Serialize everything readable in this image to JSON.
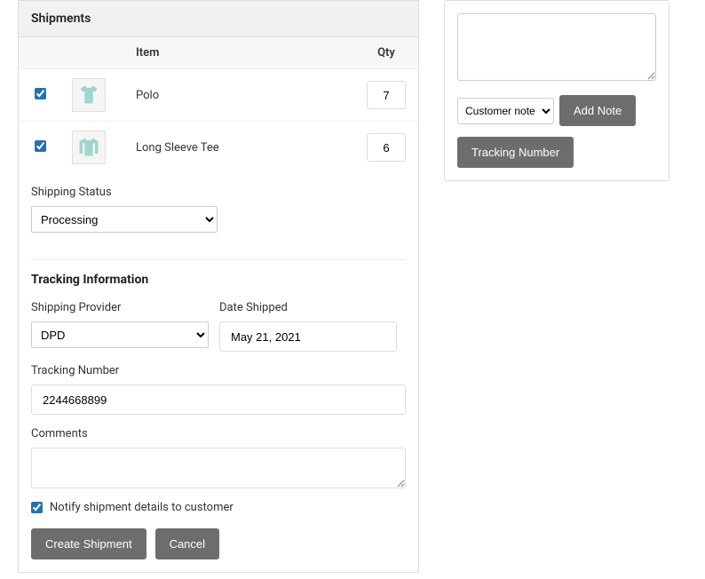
{
  "shipments": {
    "title": "Shipments",
    "columns": {
      "item": "Item",
      "qty": "Qty"
    },
    "rows": [
      {
        "name": "Polo",
        "qty": "7",
        "icon": "polo"
      },
      {
        "name": "Long Sleeve Tee",
        "qty": "6",
        "icon": "long-sleeve"
      }
    ]
  },
  "shipping_status": {
    "label": "Shipping Status",
    "value": "Processing"
  },
  "tracking": {
    "title": "Tracking Information",
    "provider_label": "Shipping Provider",
    "provider_value": "DPD",
    "date_label": "Date Shipped",
    "date_value": "May 21, 2021",
    "number_label": "Tracking Number",
    "number_value": "2244668899",
    "comments_label": "Comments",
    "comments_value": "",
    "notify_label": "Notify shipment details to customer",
    "create_btn": "Create Shipment",
    "cancel_btn": "Cancel"
  },
  "notes": {
    "type_value": "Customer note",
    "add_btn": "Add Note",
    "tracking_btn": "Tracking Number"
  }
}
